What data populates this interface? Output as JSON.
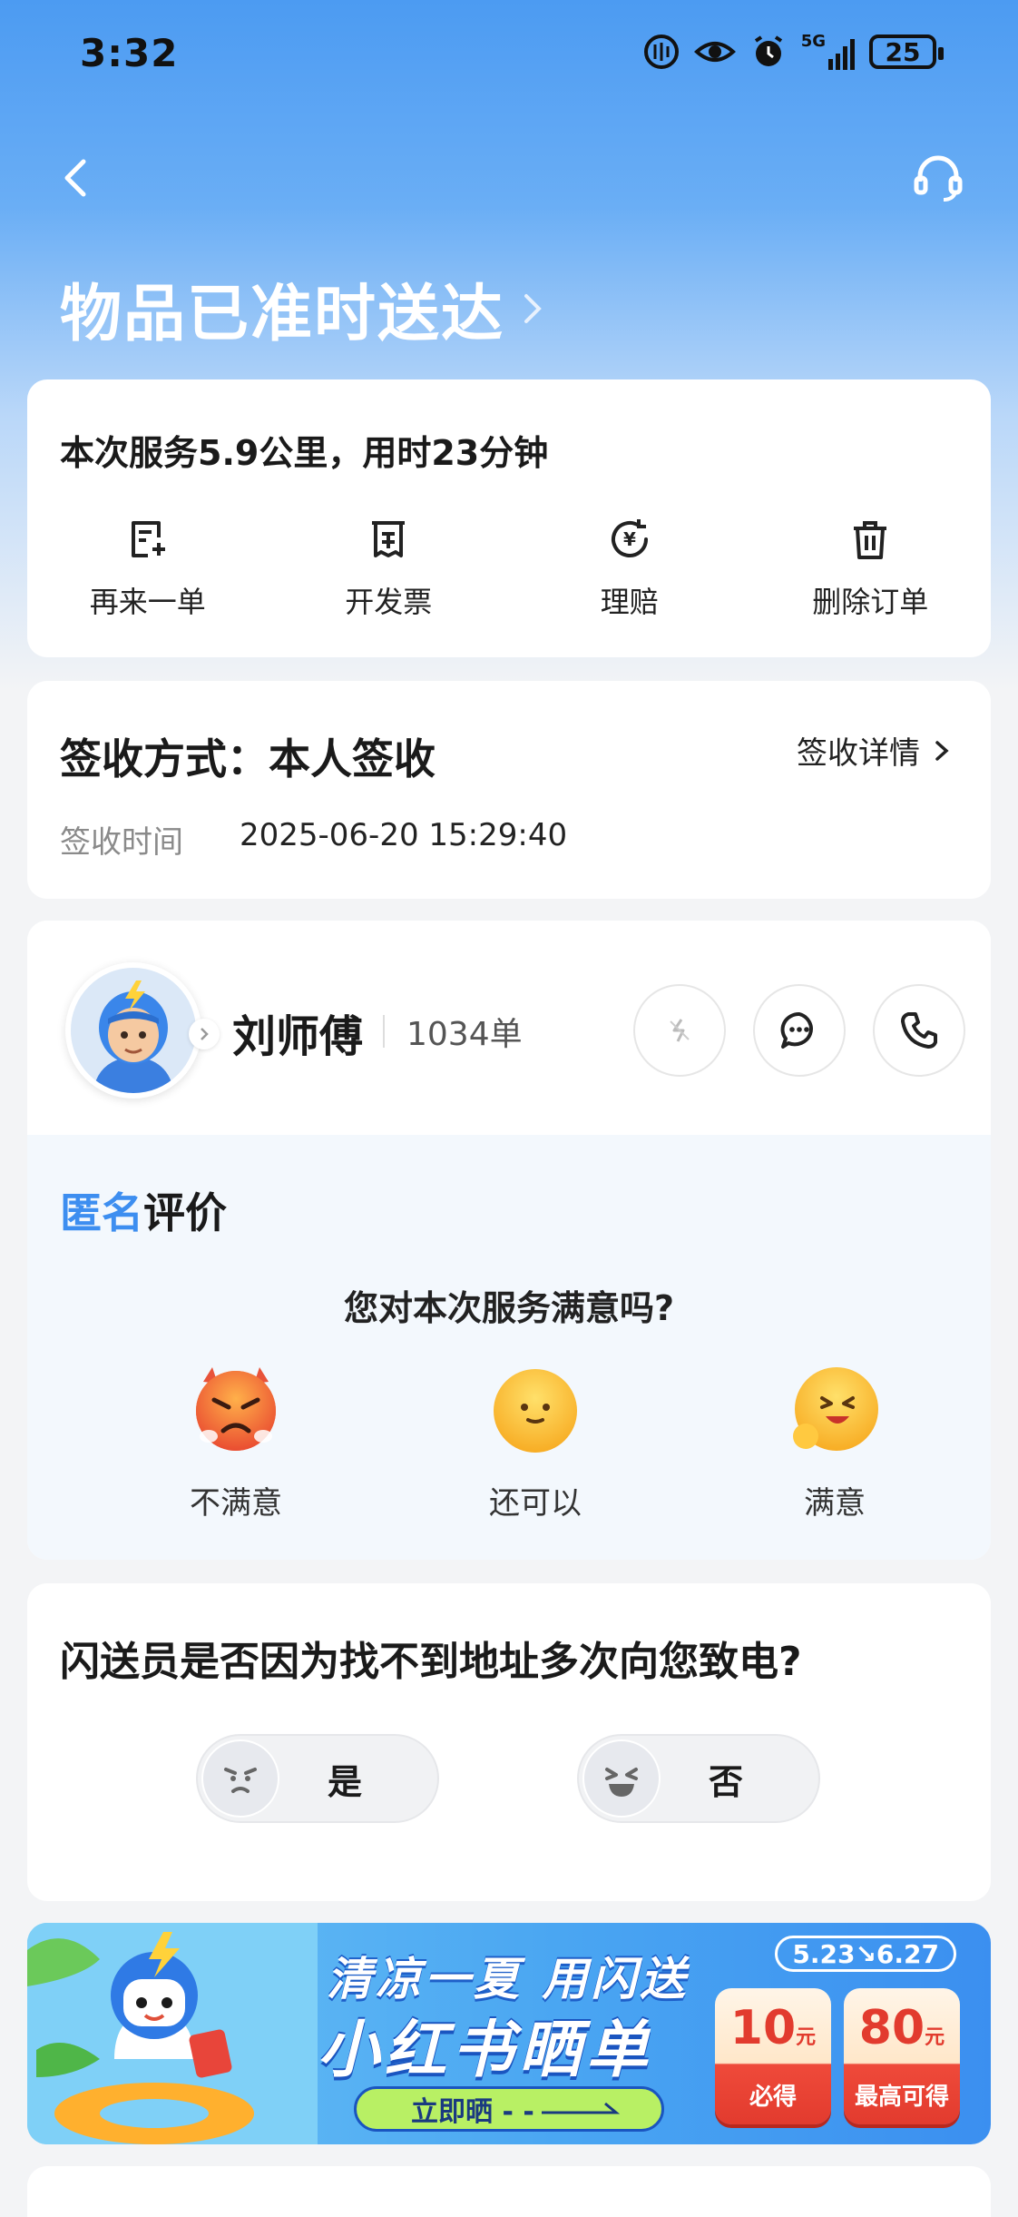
{
  "status_bar": {
    "time": "3:32",
    "battery": "25",
    "network": "5G"
  },
  "header": {
    "title": "物品已准时送达"
  },
  "summary": {
    "text": "本次服务5.9公里，用时23分钟",
    "actions": [
      {
        "label": "再来一单",
        "icon": "reorder-icon"
      },
      {
        "label": "开发票",
        "icon": "invoice-icon"
      },
      {
        "label": "理赔",
        "icon": "claim-icon"
      },
      {
        "label": "删除订单",
        "icon": "trash-icon"
      }
    ]
  },
  "sign": {
    "method": "签收方式：本人签收",
    "detail_link": "签收详情",
    "time_label": "签收时间",
    "time_value": "2025-06-20 15:29:40"
  },
  "rider": {
    "name": "刘师傅",
    "orders": "1034单"
  },
  "review": {
    "title_highlight": "匿名",
    "title_rest": "评价",
    "question": "您对本次服务满意吗?",
    "options": [
      {
        "label": "不满意"
      },
      {
        "label": "还可以"
      },
      {
        "label": "满意"
      }
    ]
  },
  "survey": {
    "question": "闪送员是否因为找不到地址多次向您致电?",
    "yes": "是",
    "no": "否"
  },
  "banner": {
    "line1": "清凉一夏 用闪送",
    "line2": "小红书晒单",
    "cta": "立即晒 - -",
    "date": "5.23↘6.27",
    "coupons": [
      {
        "amount": "10",
        "unit": "元",
        "label": "必得"
      },
      {
        "amount": "80",
        "unit": "元",
        "label": "最高可得"
      }
    ]
  },
  "colors": {
    "accent": "#3d8ef0",
    "header_bg": "#4c9bf2"
  }
}
